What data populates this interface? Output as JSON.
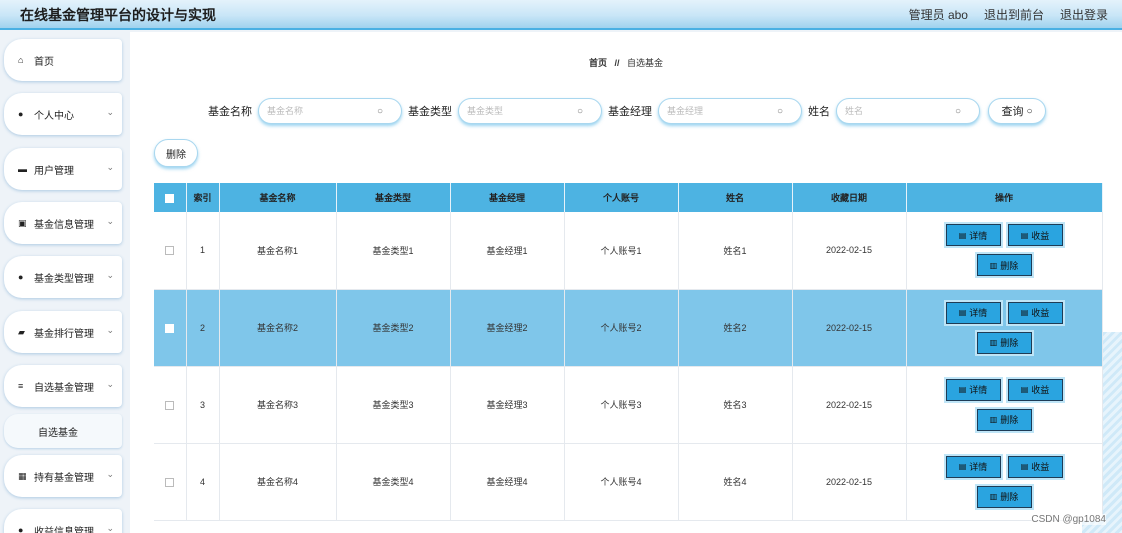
{
  "app": {
    "title": "在线基金管理平台的设计与实现"
  },
  "header": {
    "user": "管理员 abo",
    "front": "退出到前台",
    "logout": "退出登录"
  },
  "sidebar": {
    "items": [
      {
        "label": "首页",
        "icon": "home-icon",
        "glyph": "⌂"
      },
      {
        "label": "个人中心",
        "icon": "user-icon",
        "glyph": "●"
      },
      {
        "label": "用户管理",
        "icon": "user-card-icon",
        "glyph": "▬"
      },
      {
        "label": "基金信息管理",
        "icon": "clipboard-icon",
        "glyph": "▣"
      },
      {
        "label": "基金类型管理",
        "icon": "person-icon",
        "glyph": "●"
      },
      {
        "label": "基金排行管理",
        "icon": "ticket-icon",
        "glyph": "▰"
      },
      {
        "label": "自选基金管理",
        "icon": "sliders-icon",
        "glyph": "≡"
      },
      {
        "label": "持有基金管理",
        "icon": "grid-icon",
        "glyph": "▦"
      },
      {
        "label": "收益信息管理",
        "icon": "person-icon",
        "glyph": "●"
      }
    ],
    "submenu": {
      "label": "自选基金"
    }
  },
  "breadcrumb": {
    "home": "首页",
    "sep": "//",
    "current": "自选基金"
  },
  "search": {
    "fields": [
      {
        "label": "基金名称",
        "placeholder": "基金名称"
      },
      {
        "label": "基金类型",
        "placeholder": "基金类型"
      },
      {
        "label": "基金经理",
        "placeholder": "基金经理"
      },
      {
        "label": "姓名",
        "placeholder": "姓名"
      }
    ],
    "query": "查询"
  },
  "toolbar": {
    "delete": "删除"
  },
  "table": {
    "headers": [
      "索引",
      "基金名称",
      "基金类型",
      "基金经理",
      "个人账号",
      "姓名",
      "收藏日期",
      "操作"
    ],
    "rows": [
      {
        "index": "1",
        "name": "基金名称1",
        "type": "基金类型1",
        "manager": "基金经理1",
        "account": "个人账号1",
        "person": "姓名1",
        "date": "2022-02-15"
      },
      {
        "index": "2",
        "name": "基金名称2",
        "type": "基金类型2",
        "manager": "基金经理2",
        "account": "个人账号2",
        "person": "姓名2",
        "date": "2022-02-15"
      },
      {
        "index": "3",
        "name": "基金名称3",
        "type": "基金类型3",
        "manager": "基金经理3",
        "account": "个人账号3",
        "person": "姓名3",
        "date": "2022-02-15"
      },
      {
        "index": "4",
        "name": "基金名称4",
        "type": "基金类型4",
        "manager": "基金经理4",
        "account": "个人账号4",
        "person": "姓名4",
        "date": "2022-02-15"
      }
    ],
    "actions": {
      "detail": "详情",
      "income": "收益",
      "delete": "删除"
    }
  },
  "watermark": "CSDN @gp1084",
  "colors": {
    "accent": "#4db3e2",
    "highlight": "#7fc6ea",
    "button": "#2aa4e0"
  }
}
